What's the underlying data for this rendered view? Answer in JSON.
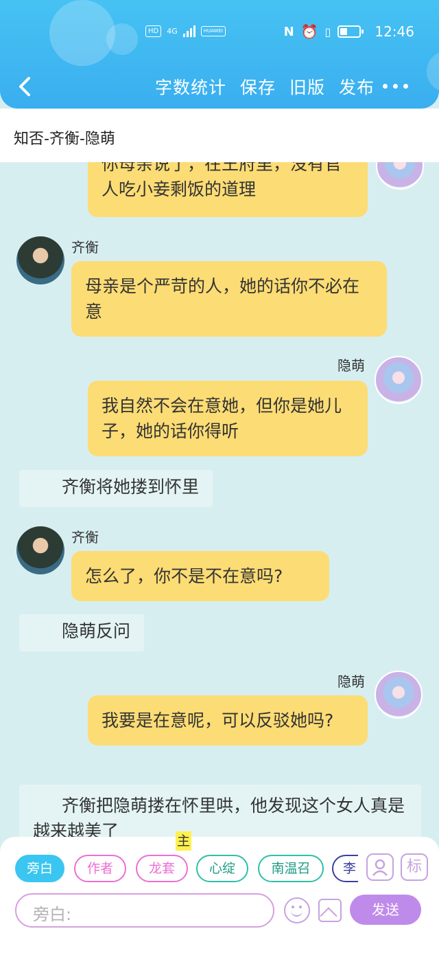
{
  "status_bar": {
    "hd": "HD",
    "network": "4G",
    "carrier_badge": "HUAWEI",
    "time": "12:46"
  },
  "toolbar": {
    "back_icon": "chevron-left-icon",
    "items": [
      "字数统计",
      "保存",
      "旧版",
      "发布"
    ],
    "more_icon": "more-dots-icon"
  },
  "document": {
    "title": "知否-齐衡-隐萌"
  },
  "chat": {
    "partial_message": "你母亲说了，在王府里，没有官人吃小妾剩饭的道理",
    "partial_line2": "官人吃小妾剩饭的道理",
    "messages": [
      {
        "speaker": "齐衡",
        "text": "母亲是个严苛的人，她的话你不必在意"
      },
      {
        "speaker": "隐萌",
        "text": "我自然不会在意她，但你是她儿子，她的话你得听"
      },
      {
        "narration": "齐衡将她搂到怀里"
      },
      {
        "speaker": "齐衡",
        "text": "怎么了，你不是不在意吗?"
      },
      {
        "narration": "隐萌反问"
      },
      {
        "speaker": "隐萌",
        "text": "我要是在意呢，可以反驳她吗?"
      },
      {
        "narration": "齐衡把隐萌搂在怀里哄，他发现这个女人真是越来越美了"
      }
    ]
  },
  "composer": {
    "chips": [
      "旁白",
      "作者",
      "龙套",
      "心绽",
      "南温召",
      "李"
    ],
    "highlight_char": "主",
    "contact_icon": "contact-card-icon",
    "mark_label": "标",
    "input_placeholder": "旁白:",
    "emoji_icon": "emoji-icon",
    "image_icon": "image-icon",
    "send_label": "发送"
  },
  "colors": {
    "header": "#3fb8f1",
    "bubble": "#fcdc74",
    "chat_bg": "#d7eef1",
    "accent_purple": "#bf8bea"
  }
}
